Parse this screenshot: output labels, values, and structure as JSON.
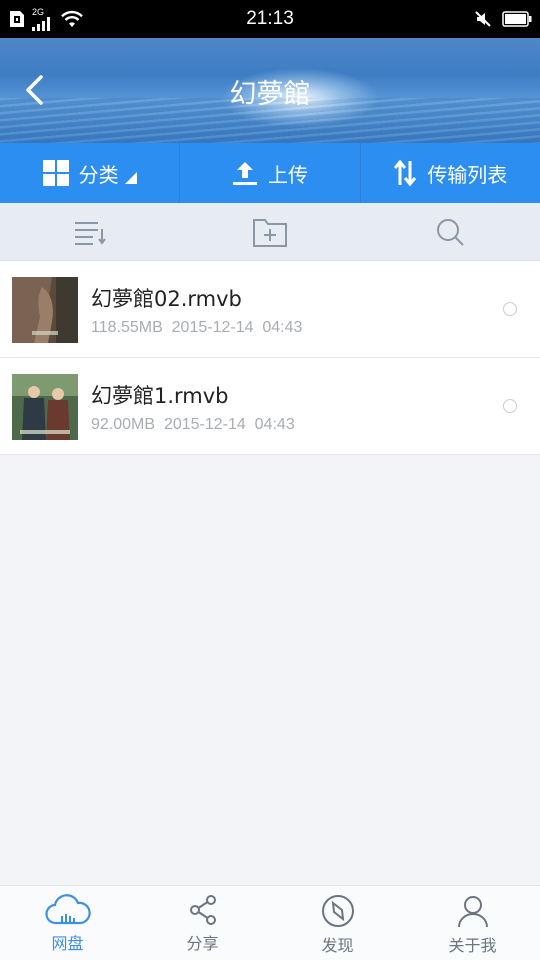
{
  "status_bar": {
    "network": "2G",
    "time": "21:13"
  },
  "header": {
    "title": "幻夢館"
  },
  "action_bar": {
    "category_label": "分类",
    "upload_label": "上传",
    "transfer_label": "传输列表"
  },
  "toolbar": {
    "icons": [
      "sort-icon",
      "new-folder-icon",
      "search-icon"
    ]
  },
  "files": [
    {
      "name": "幻夢館02.rmvb",
      "size": "118.55MB",
      "date": "2015-12-14  04:43"
    },
    {
      "name": "幻夢館1.rmvb",
      "size": "92.00MB",
      "date": "2015-12-14  04:43"
    }
  ],
  "tabs": [
    {
      "label": "网盘",
      "icon": "cloud-icon",
      "active": true
    },
    {
      "label": "分享",
      "icon": "share-icon",
      "active": false
    },
    {
      "label": "发现",
      "icon": "compass-icon",
      "active": false
    },
    {
      "label": "关于我",
      "icon": "person-icon",
      "active": false
    }
  ],
  "colors": {
    "accent": "#2d8ef2",
    "active_tab": "#3d8fe3"
  }
}
